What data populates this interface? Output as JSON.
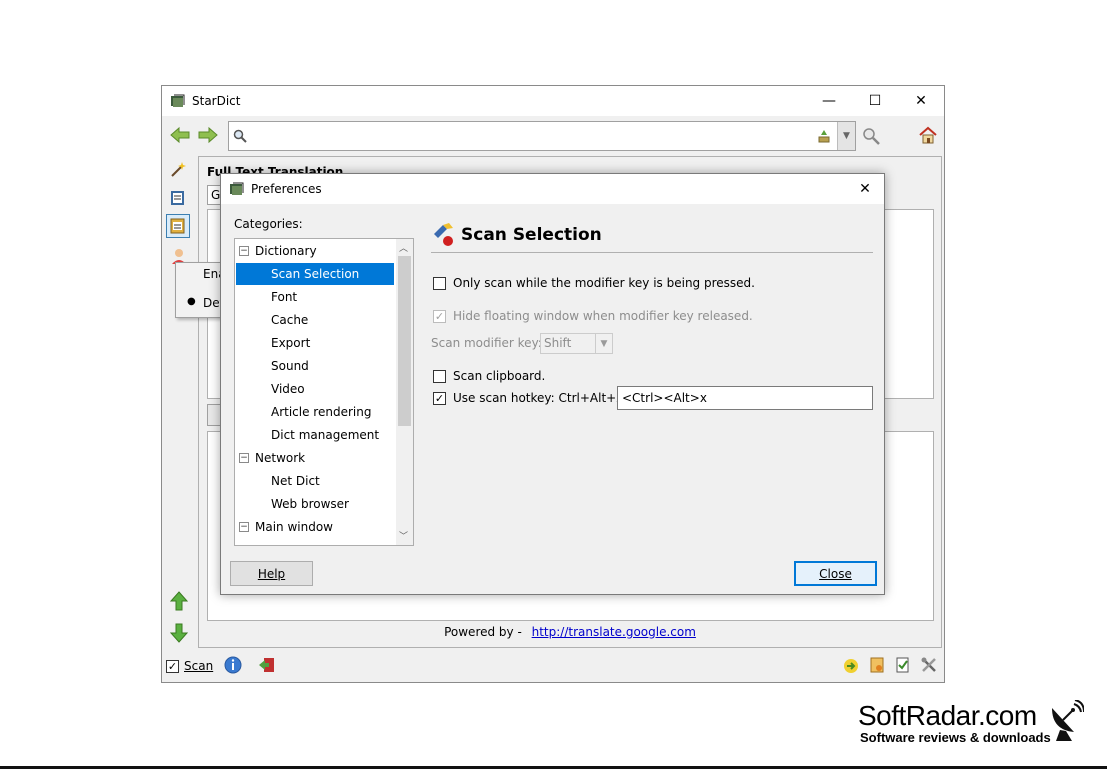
{
  "main_window": {
    "title": "StarDict",
    "controls": {
      "minimize": "—",
      "maximize": "☐",
      "close": "✕"
    },
    "search_placeholder": "",
    "background_title": "Full Text Translation",
    "background_field": "Go",
    "powered_by_label": "Powered by -",
    "powered_by_link": "http://translate.google.com",
    "status_bar": {
      "scan_label": "Scan",
      "scan_checked": true
    },
    "context_menu": {
      "items": [
        "Ena",
        "Def"
      ]
    }
  },
  "prefs": {
    "title": "Preferences",
    "categories_label": "Categories:",
    "tree": [
      {
        "label": "Dictionary",
        "level": 0,
        "expanded": true
      },
      {
        "label": "Scan Selection",
        "level": 1,
        "selected": true
      },
      {
        "label": "Font",
        "level": 1
      },
      {
        "label": "Cache",
        "level": 1
      },
      {
        "label": "Export",
        "level": 1
      },
      {
        "label": "Sound",
        "level": 1
      },
      {
        "label": "Video",
        "level": 1
      },
      {
        "label": "Article rendering",
        "level": 1
      },
      {
        "label": "Dict management",
        "level": 1
      },
      {
        "label": "Network",
        "level": 0,
        "expanded": true
      },
      {
        "label": "Net Dict",
        "level": 1
      },
      {
        "label": "Web browser",
        "level": 1
      },
      {
        "label": "Main window",
        "level": 0,
        "expanded": true
      }
    ],
    "section_title": "Scan Selection",
    "options": {
      "only_scan_modifier": {
        "label": "Only scan while the modifier key is being pressed.",
        "checked": false
      },
      "hide_floating": {
        "label": "Hide floating window when modifier key released.",
        "checked": true,
        "disabled": true
      },
      "scan_modifier_key_label": "Scan modifier key:",
      "scan_modifier_key_value": "Shift",
      "scan_clipboard": {
        "label": "Scan clipboard.",
        "checked": false
      },
      "use_scan_hotkey": {
        "label": "Use scan hotkey: Ctrl+Alt+X.",
        "checked": true
      },
      "hotkey_value": "<Ctrl><Alt>x"
    },
    "buttons": {
      "help": "Help",
      "close": "Close"
    }
  },
  "watermark": {
    "brand": "SoftRadar.com",
    "tagline": "Software reviews & downloads"
  },
  "colors": {
    "selection": "#0078d7",
    "link": "#0000cc",
    "window_bg": "#f0f0f0"
  }
}
